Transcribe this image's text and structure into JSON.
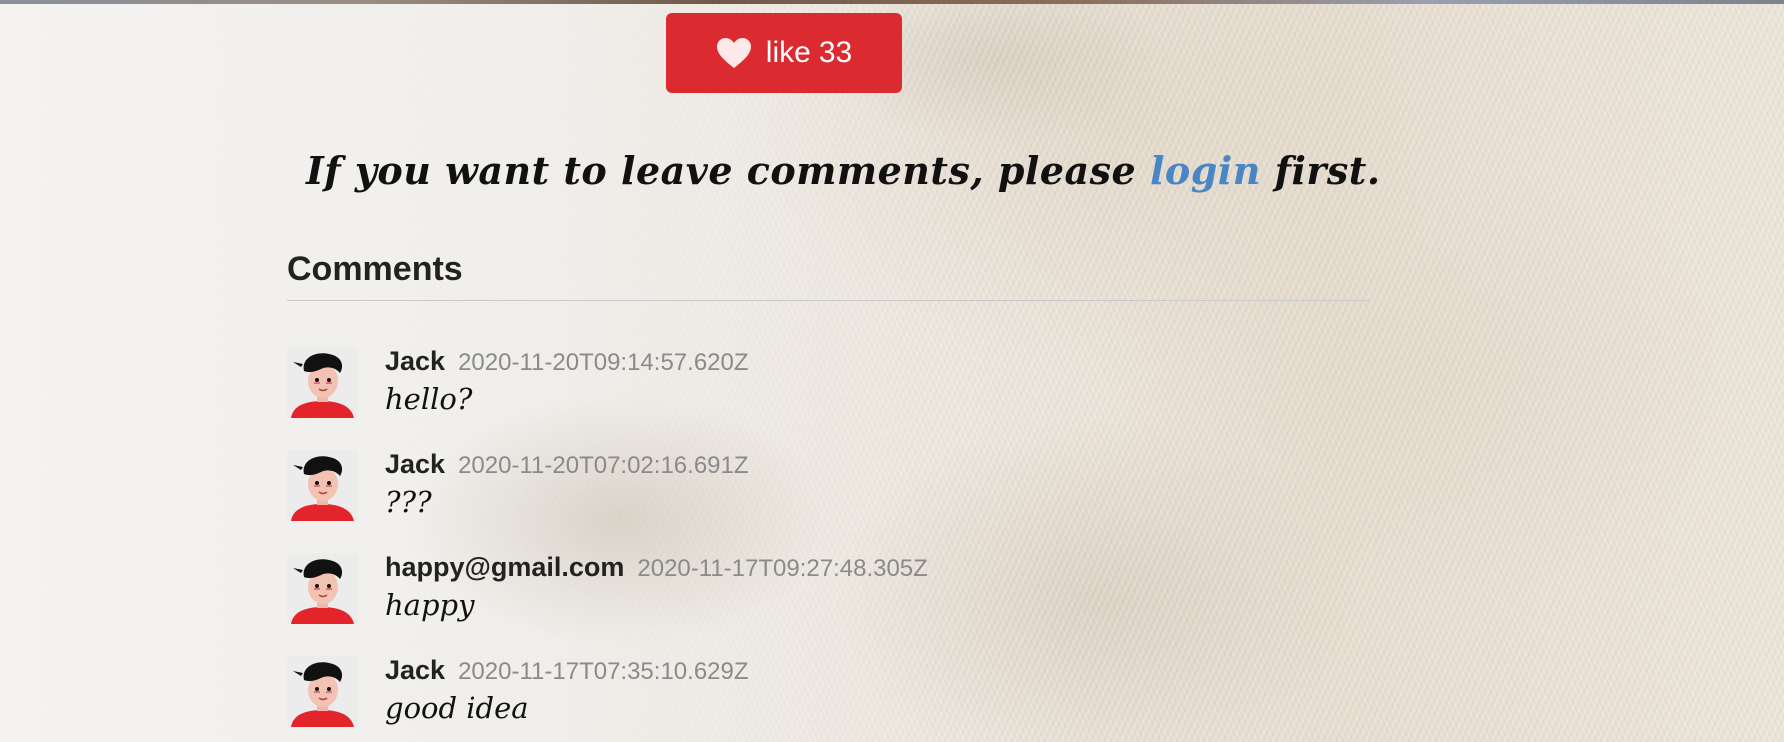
{
  "like": {
    "label": "like",
    "count": "33",
    "icon": "heart-icon",
    "color": "#dc2b30"
  },
  "login_prompt": {
    "before": "If you want to leave comments, please",
    "link": "login",
    "after": "first.",
    "link_color": "#4a86c5"
  },
  "comments": {
    "title": "Comments",
    "items": [
      {
        "author": "Jack",
        "timestamp": "2020-11-20T09:14:57.620Z",
        "text": "hello?"
      },
      {
        "author": "Jack",
        "timestamp": "2020-11-20T07:02:16.691Z",
        "text": "???"
      },
      {
        "author": "happy@gmail.com",
        "timestamp": "2020-11-17T09:27:48.305Z",
        "text": "happy"
      },
      {
        "author": "Jack",
        "timestamp": "2020-11-17T07:35:10.629Z",
        "text": "good idea"
      }
    ]
  }
}
